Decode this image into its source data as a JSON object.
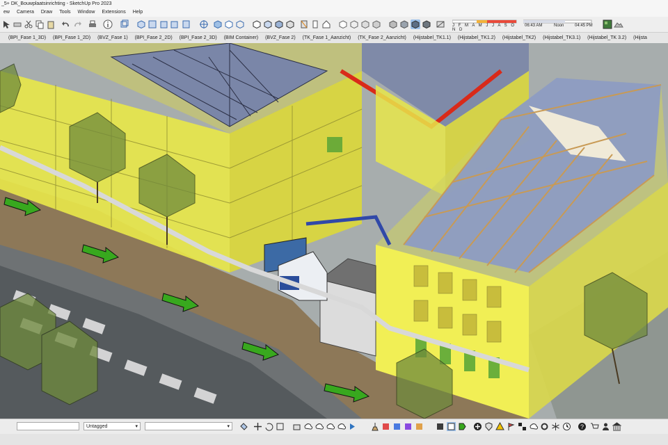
{
  "window": {
    "title": "_5+ DK_Bouwplaatsinrichting - SketchUp Pro 2023"
  },
  "menu": [
    "ew",
    "Camera",
    "Draw",
    "Tools",
    "Window",
    "Extensions",
    "Help"
  ],
  "toolbar": {
    "months": "J F M A M J J A S O N D",
    "time_start": "06:43 AM",
    "time_noon": "Noon",
    "time_end": "04:45 PM"
  },
  "tabs": [
    "(BPI_Fase 1_3D)",
    "(BPI_Fase 1_2D)",
    "(BVZ_Fase 1)",
    "(BPI_Fase 2_2D)",
    "(BPI_Fase 2_3D)",
    "(BIM Container)",
    "(BVZ_Fase 2)",
    "(TK_Fase 1_Aanzicht)",
    "(TK_Fase 2_Aanzicht)",
    "(Hijstabel_TK1.1)",
    "(Hijstabel_TK1.2)",
    "(Hijstabel_TK2)",
    "(Hijstabel_TK3.1)",
    "(Hijstabel_TK 3.2)",
    "(Hijsta"
  ],
  "status": {
    "tag": "Untagged"
  },
  "colors": {
    "yellow_volume": "#e7e64a",
    "roof": "#7a86a8",
    "timber": "#c89a55",
    "arrow": "#2f8a1a",
    "road": "#6c6f72"
  }
}
